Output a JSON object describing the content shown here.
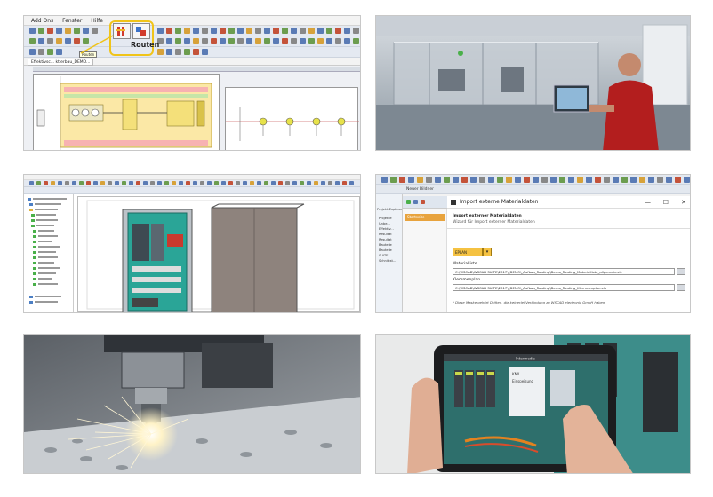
{
  "tile1": {
    "menu": [
      "Add Ons",
      "Fenster",
      "Hilfe"
    ],
    "tooltip": "Routen",
    "callout_label": "Routen",
    "tab_label": "Effektivsc... ktierbau_DEMO..."
  },
  "tile4": {
    "toolbar_title": "Neuer Bildner",
    "sidebar_title": "Projekt-Explorer",
    "dialog_title": "Import externe Materialdaten",
    "sidebar_item": "Startseite",
    "header_bold": "Import externer Materialdaten",
    "header_sub": "Wizard für Import externer Materialdaten",
    "combo_value": "EPLAN",
    "label_material": "Materialliste",
    "path_material": "C:\\WSCAD\\WSCAD SUITE\\2017\\_DEMO\\_Aufbau_Routing\\Demo_Routing_Materialliste_allgemein.xls",
    "label_clamp": "Klemmenplan",
    "path_clamp": "C:\\WSCAD\\WSCAD SUITE\\2017\\_DEMO\\_Aufbau_Routing\\Demo_Routing_Klemmenplan.xls",
    "footnote": "* Diese Maske gehört Dritten, die keinerlei Verbindung zu WSCAD electronic GmbH haben",
    "tree": [
      "Projekte",
      "Unbe...",
      "Effektiv...",
      "Resultat",
      "Resultat",
      "Bauteile",
      "Bauteile",
      "SUITE...",
      "Schnittst..."
    ],
    "win_minimize": "—",
    "win_maximize": "☐",
    "win_close": "✕"
  },
  "tile6": {
    "tablet_label": "Intermedia",
    "panel_line1": "KNX",
    "panel_line2": "Einspeisung"
  }
}
